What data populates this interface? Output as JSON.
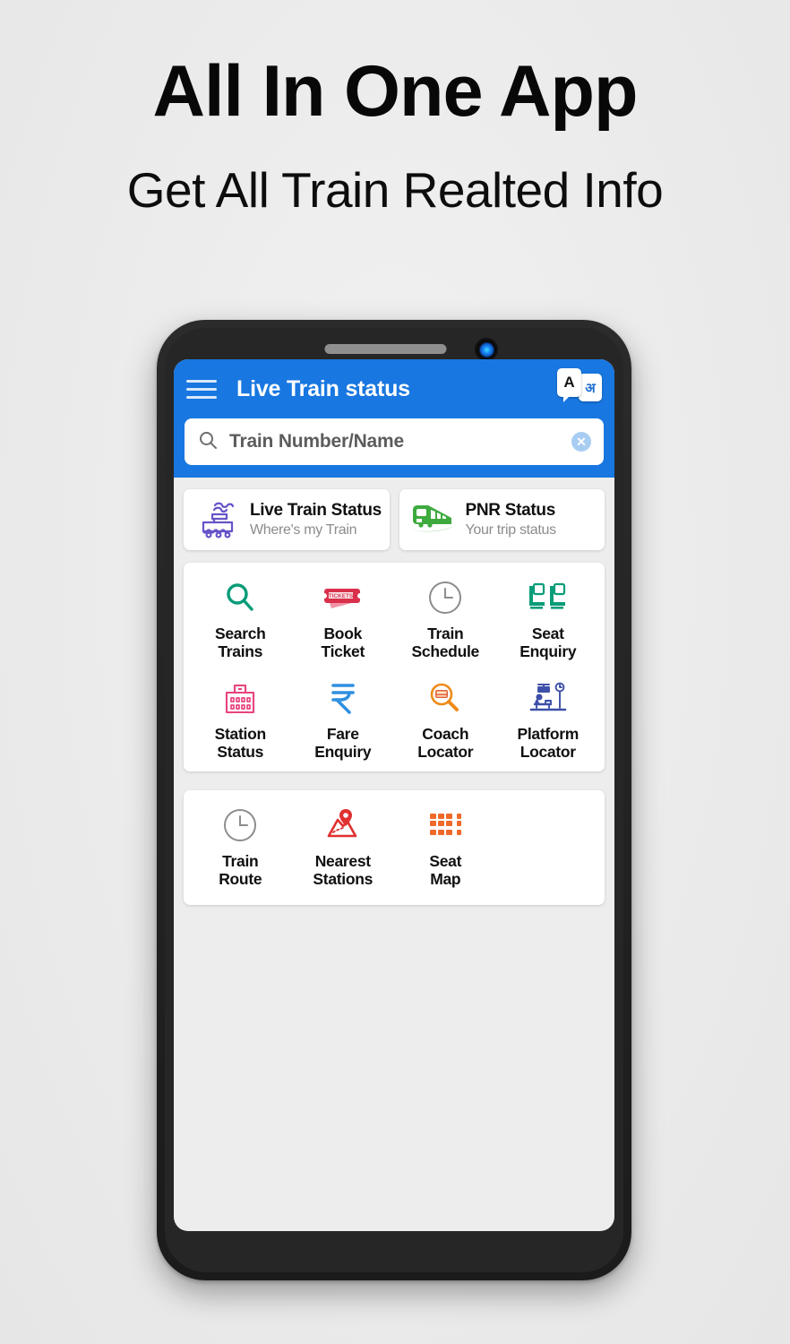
{
  "promo": {
    "headline": "All In One App",
    "subheadline": "Get All Train Realted Info"
  },
  "phone": {
    "earpiece_icon": "earpiece-speaker",
    "camera_icon": "front-camera"
  },
  "appbar": {
    "menu_icon": "hamburger-menu-icon",
    "title": "Live Train status",
    "translate_icon": "translate-icon",
    "translate_latin_char": "A",
    "translate_devanagari_char": "अ",
    "background_color": "#1877e0"
  },
  "search": {
    "icon": "search-icon",
    "placeholder": "Train Number/Name",
    "value": "",
    "clear_icon": "clear-circle-icon"
  },
  "promo_cards": [
    {
      "title": "Live Train Status",
      "subtitle": "Where's my Train",
      "icon": "steam-train-icon",
      "color": "#6654c8"
    },
    {
      "title": "PNR Status",
      "subtitle": "Your trip status",
      "icon": "train-front-icon",
      "color": "#3eaa3e"
    }
  ],
  "menu_grid": [
    {
      "label_line1": "Search",
      "label_line2": "Trains",
      "icon": "search-magnifier-icon",
      "color": "#089c78"
    },
    {
      "label_line1": "Book",
      "label_line2": "Ticket",
      "icon": "tickets-icon",
      "color": "#e0364f"
    },
    {
      "label_line1": "Train",
      "label_line2": "Schedule",
      "icon": "clock-icon",
      "color": "#8c8c8c"
    },
    {
      "label_line1": "Seat",
      "label_line2": "Enquiry",
      "icon": "seats-icon",
      "color": "#089c78"
    },
    {
      "label_line1": "Station",
      "label_line2": "Status",
      "icon": "station-building-icon",
      "color": "#e8437f"
    },
    {
      "label_line1": "Fare",
      "label_line2": "Enquiry",
      "icon": "rupee-icon",
      "color": "#2f8fe0"
    },
    {
      "label_line1": "Coach",
      "label_line2": "Locator",
      "icon": "coach-magnifier-icon",
      "color": "#ef8b1b"
    },
    {
      "label_line1": "Platform",
      "label_line2": "Locator",
      "icon": "platform-bench-icon",
      "color": "#3d4fa8"
    }
  ],
  "bottom_grid": [
    {
      "label_line1": "Train",
      "label_line2": "Route",
      "icon": "clock-icon",
      "color": "#8c8c8c"
    },
    {
      "label_line1": "Nearest",
      "label_line2": "Stations",
      "icon": "map-pin-icon",
      "color": "#e03030"
    },
    {
      "label_line1": "Seat",
      "label_line2": "Map",
      "icon": "seat-grid-icon",
      "color": "#ef6a2a"
    }
  ]
}
